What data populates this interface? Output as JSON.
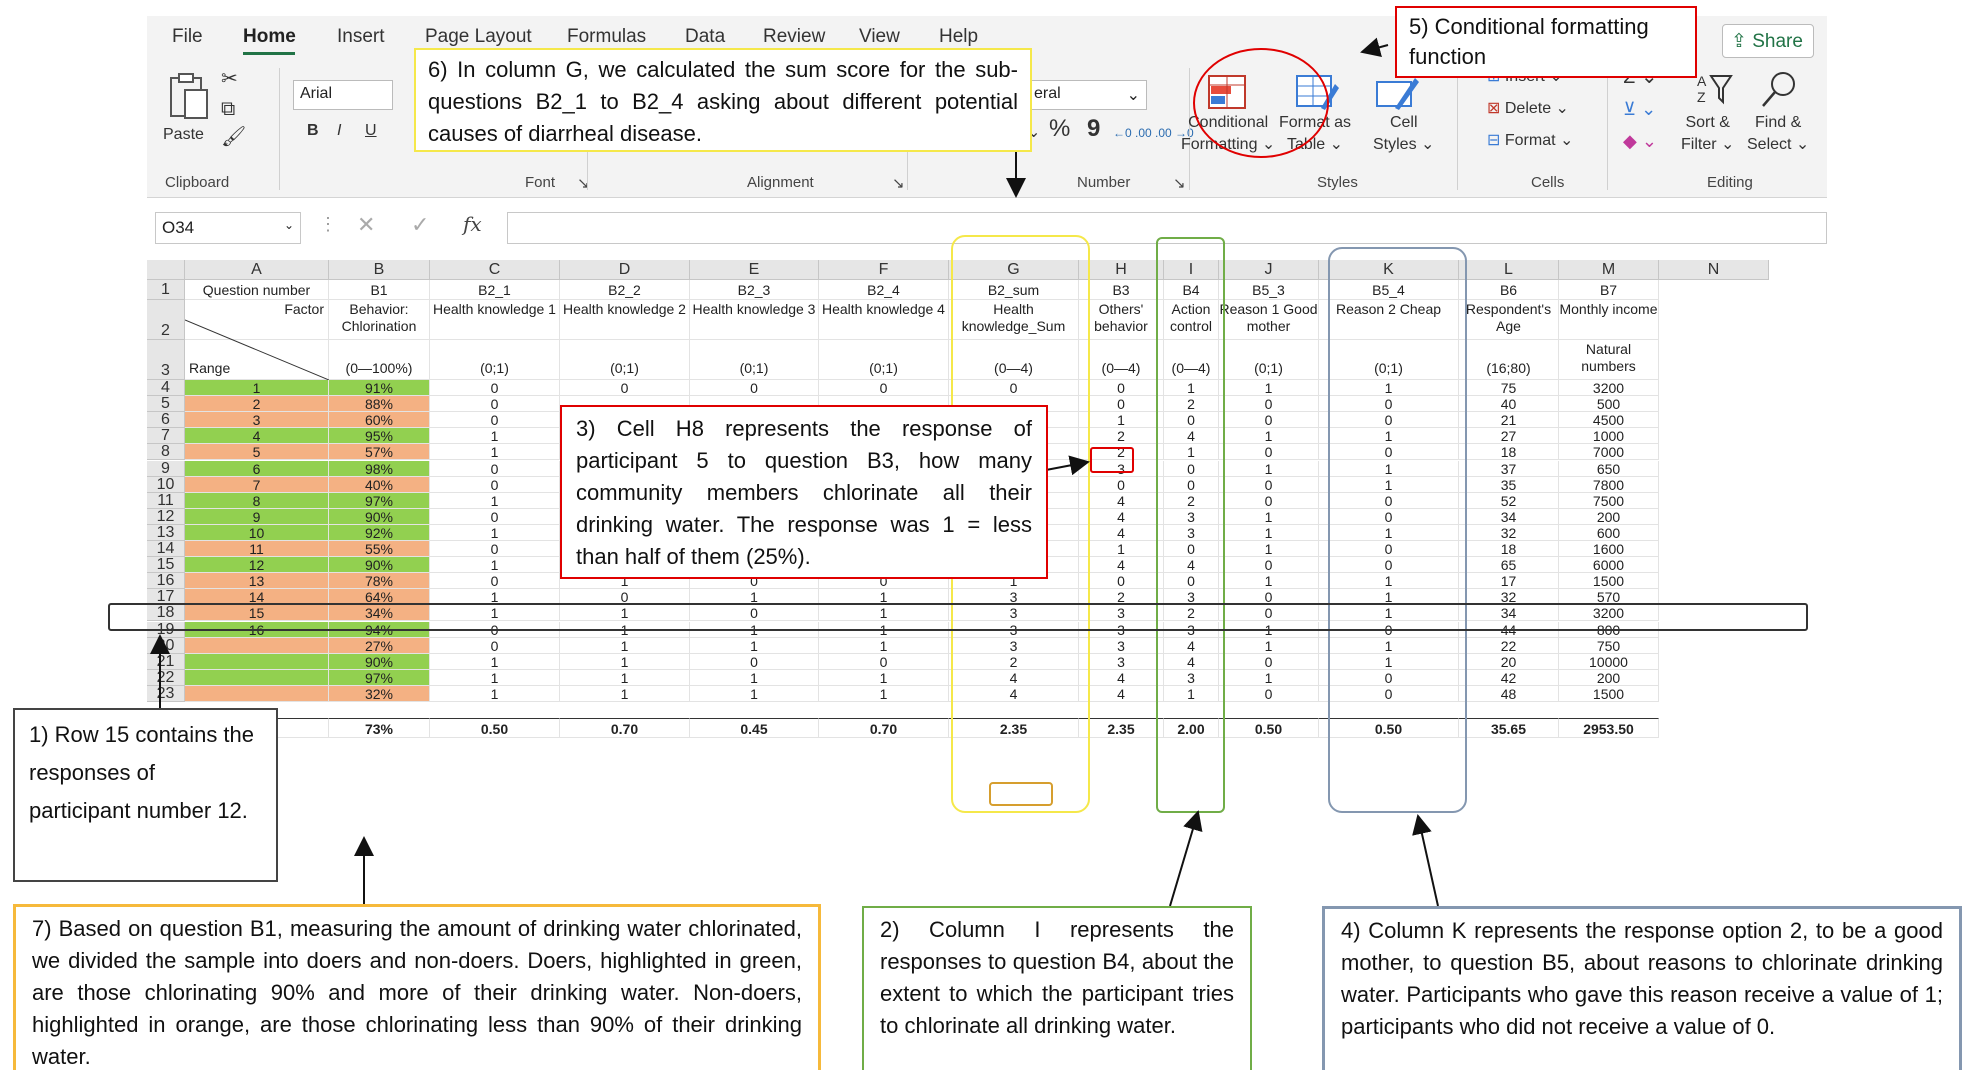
{
  "menu": {
    "tabs": [
      "File",
      "Home",
      "Insert",
      "Page Layout",
      "Formulas",
      "Data",
      "Review",
      "View",
      "Help"
    ],
    "share": "Share"
  },
  "ribbon": {
    "clipboard": {
      "paste": "Paste",
      "group": "Clipboard"
    },
    "font": {
      "name": "Arial",
      "bold": "B",
      "italic": "I",
      "underline": "U",
      "group": "Font"
    },
    "alignment": {
      "group": "Alignment"
    },
    "number": {
      "format": "eral",
      "percent": "%",
      "comma": "9",
      "inc": "←0 .00",
      "dec": ".00 →0",
      "group": "Number"
    },
    "styles": {
      "cond1": "Conditional",
      "cond2": "Formatting",
      "fmt1": "Format as",
      "fmt2": "Table",
      "cell1": "Cell",
      "cell2": "Styles",
      "group": "Styles"
    },
    "cells": {
      "insert": "Insert",
      "delete": "Delete",
      "format": "Format",
      "group": "Cells"
    },
    "editing": {
      "sort1": "Sort &",
      "sort2": "Filter",
      "find1": "Find &",
      "find2": "Select",
      "group": "Editing"
    }
  },
  "formula_bar": {
    "name_box": "O34",
    "fx": "fx"
  },
  "columns": [
    "A",
    "B",
    "C",
    "D",
    "E",
    "F",
    "G",
    "H",
    "I",
    "J",
    "K",
    "L",
    "M",
    "N"
  ],
  "header_rows": {
    "r1": [
      "Question number",
      "B1",
      "B2_1",
      "B2_2",
      "B2_3",
      "B2_4",
      "B2_sum",
      "B3",
      "B4",
      "B5_3",
      "B5_4",
      "B6",
      "B7"
    ],
    "r2": [
      "Factor",
      "Behavior: Chlorination",
      "Health knowledge 1",
      "Health knowledge 2",
      "Health knowledge 3",
      "Health knowledge 4",
      "Health knowledge_Sum",
      "Others' behavior",
      "Action control",
      "Reason 1 Good mother",
      "Reason 2 Cheap",
      "Respondent's Age",
      "Monthly income"
    ],
    "r3": [
      "Range",
      "(0—100%)",
      "(0;1)",
      "(0;1)",
      "(0;1)",
      "(0;1)",
      "(0—4)",
      "(0—4)",
      "(0—4)",
      "(0;1)",
      "(0;1)",
      "(16;80)",
      "Natural numbers"
    ]
  },
  "data_rows": [
    [
      "1",
      "91%",
      "0",
      "0",
      "0",
      "0",
      "0",
      "0",
      "1",
      "1",
      "1",
      "75",
      "3200"
    ],
    [
      "2",
      "88%",
      "0",
      "",
      "",
      "",
      "",
      "0",
      "2",
      "0",
      "0",
      "40",
      "500"
    ],
    [
      "3",
      "60%",
      "0",
      "",
      "",
      "",
      "",
      "1",
      "0",
      "0",
      "0",
      "21",
      "4500"
    ],
    [
      "4",
      "95%",
      "1",
      "",
      "",
      "",
      "",
      "2",
      "4",
      "1",
      "1",
      "27",
      "1000"
    ],
    [
      "5",
      "57%",
      "1",
      "",
      "",
      "",
      "",
      "2",
      "1",
      "0",
      "0",
      "18",
      "7000"
    ],
    [
      "6",
      "98%",
      "0",
      "",
      "",
      "",
      "",
      "3",
      "0",
      "1",
      "1",
      "37",
      "650"
    ],
    [
      "7",
      "40%",
      "0",
      "",
      "",
      "",
      "",
      "0",
      "0",
      "0",
      "1",
      "35",
      "7800"
    ],
    [
      "8",
      "97%",
      "1",
      "",
      "",
      "",
      "",
      "4",
      "2",
      "0",
      "0",
      "52",
      "7500"
    ],
    [
      "9",
      "90%",
      "0",
      "",
      "",
      "",
      "",
      "4",
      "3",
      "1",
      "0",
      "34",
      "200"
    ],
    [
      "10",
      "92%",
      "1",
      "",
      "",
      "",
      "",
      "4",
      "3",
      "1",
      "1",
      "32",
      "600"
    ],
    [
      "11",
      "55%",
      "0",
      "0",
      "0",
      "1",
      "1",
      "1",
      "0",
      "1",
      "0",
      "18",
      "1600"
    ],
    [
      "12",
      "90%",
      "1",
      "1",
      "0",
      "1",
      "3",
      "4",
      "4",
      "0",
      "0",
      "65",
      "6000"
    ],
    [
      "13",
      "78%",
      "0",
      "1",
      "0",
      "0",
      "1",
      "0",
      "0",
      "1",
      "1",
      "17",
      "1500"
    ],
    [
      "14",
      "64%",
      "1",
      "0",
      "1",
      "1",
      "3",
      "2",
      "3",
      "0",
      "1",
      "32",
      "570"
    ],
    [
      "15",
      "34%",
      "1",
      "1",
      "0",
      "1",
      "3",
      "3",
      "2",
      "0",
      "1",
      "34",
      "3200"
    ],
    [
      "16",
      "94%",
      "0",
      "1",
      "1",
      "1",
      "3",
      "3",
      "3",
      "1",
      "0",
      "44",
      "800"
    ],
    [
      "",
      "27%",
      "0",
      "1",
      "1",
      "1",
      "3",
      "3",
      "4",
      "1",
      "1",
      "22",
      "750"
    ],
    [
      "",
      "90%",
      "1",
      "1",
      "0",
      "0",
      "2",
      "3",
      "4",
      "0",
      "1",
      "20",
      "10000"
    ],
    [
      "",
      "97%",
      "1",
      "1",
      "1",
      "1",
      "4",
      "4",
      "3",
      "1",
      "0",
      "42",
      "200"
    ],
    [
      "",
      "32%",
      "1",
      "1",
      "1",
      "1",
      "4",
      "4",
      "1",
      "0",
      "0",
      "48",
      "1500"
    ]
  ],
  "row_colors": [
    "green",
    "orange",
    "orange",
    "green",
    "orange",
    "green",
    "orange",
    "green",
    "green",
    "green",
    "orange",
    "green",
    "orange",
    "orange",
    "orange",
    "green",
    "orange",
    "green",
    "green",
    "orange"
  ],
  "totals": [
    "",
    "73%",
    "0.50",
    "0.70",
    "0.45",
    "0.70",
    "2.35",
    "2.35",
    "2.00",
    "0.50",
    "0.50",
    "35.65",
    "2953.50"
  ],
  "colors": {
    "green": "#92d050",
    "orange": "#f4b183",
    "red": "#e00000",
    "yellow": "#f5e84a",
    "green_box": "#70ad47",
    "blue_box": "#8497b0",
    "orange_box": "#f6b93b"
  },
  "notes": {
    "n1": "1) Row 15 contains the responses of participant number 12.",
    "n2": "2) Column I represents the responses to question B4, about the extent to which the participant tries to chlorinate all drinking water.",
    "n3": "3) Cell H8 represents the response of participant 5 to question B3, how many community members chlorinate all their drinking water. The response was 1 = less than half of them (25%).",
    "n4": "4) Column K represents the response option 2, to be a good mother, to question B5, about reasons to chlorinate drinking water. Participants who gave this reason receive a value of 1; participants who did not receive a value of 0.",
    "n5": "5) Conditional formatting function",
    "n6": "6) In column G, we calculated the sum score for the sub-questions B2_1 to B2_4 asking about different potential causes of diarrheal disease.",
    "n7": "7) Based on question B1, measuring the amount of drinking water chlorinated, we divided the sample into doers and non-doers. Doers, highlighted in green, are those chlorinating 90% and more of their drinking water. Non-doers, highlighted in orange, are those chlorinating less than 90% of their drinking water."
  }
}
